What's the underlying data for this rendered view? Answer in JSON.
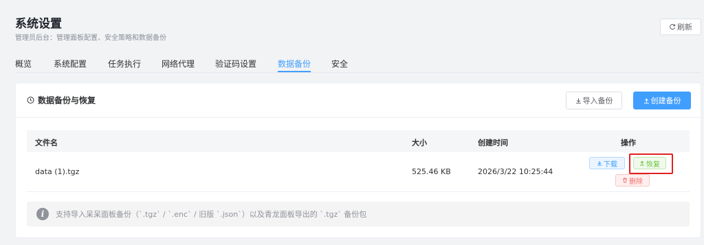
{
  "header": {
    "title": "系统设置",
    "subtitle": "管理员后台：管理面板配置、安全策略和数据备份",
    "refresh_label": "刷新",
    "refresh_icon": "refresh-icon"
  },
  "tabs": [
    {
      "label": "概览"
    },
    {
      "label": "系统配置"
    },
    {
      "label": "任务执行"
    },
    {
      "label": "网络代理"
    },
    {
      "label": "验证码设置"
    },
    {
      "label": "数据备份",
      "active": true
    },
    {
      "label": "安全"
    }
  ],
  "card": {
    "title": "数据备份与恢复",
    "title_icon": "clock-icon",
    "import_label": "导入备份",
    "create_label": "创建备份"
  },
  "table": {
    "columns": [
      "文件名",
      "大小",
      "创建时间",
      "操作"
    ],
    "rows": [
      {
        "filename": "data (1).tgz",
        "size": "525.46 KB",
        "created": "2026/3/22 10:25:44",
        "actions": {
          "download": "下载",
          "restore": "恢复",
          "delete": "删除"
        }
      }
    ]
  },
  "info": {
    "text": "支持导入呆呆面板备份（`.tgz` / `.enc` / 旧版 `.json`）以及青龙面板导出的 `.tgz` 备份包"
  },
  "colors": {
    "accent": "#409eff",
    "success": "#67c23a",
    "danger": "#f56c6c",
    "highlight": "#e02020"
  }
}
